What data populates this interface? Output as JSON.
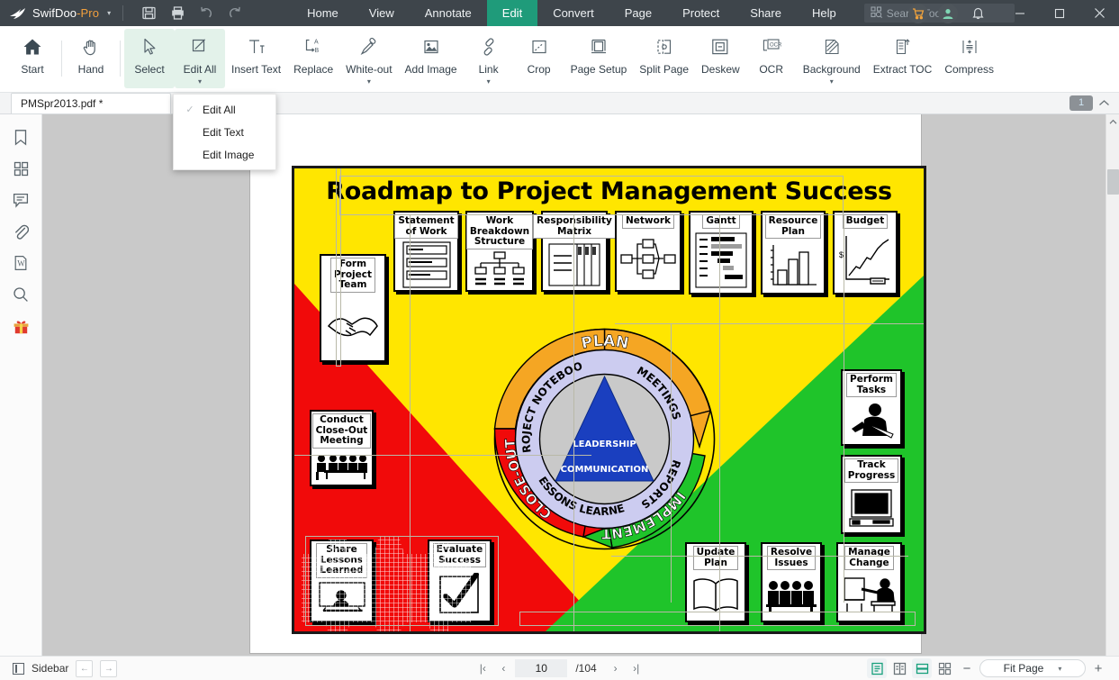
{
  "titlebar": {
    "brand_main": "SwifDoo",
    "brand_suffix": "-Pro",
    "brand_caret": "▾",
    "quick_actions": [
      {
        "name": "save-icon",
        "label": "Save"
      },
      {
        "name": "print-icon",
        "label": "Print"
      },
      {
        "name": "undo-icon",
        "label": "Undo"
      },
      {
        "name": "redo-icon",
        "label": "Redo"
      }
    ],
    "menus": [
      {
        "label": "Home",
        "active": false
      },
      {
        "label": "View",
        "active": false
      },
      {
        "label": "Annotate",
        "active": false
      },
      {
        "label": "Edit",
        "active": true
      },
      {
        "label": "Convert",
        "active": false
      },
      {
        "label": "Page",
        "active": false
      },
      {
        "label": "Protect",
        "active": false
      },
      {
        "label": "Share",
        "active": false
      },
      {
        "label": "Help",
        "active": false
      }
    ],
    "search_placeholder": "Search Tools",
    "accent_active": "#1f9b7a",
    "bar_color": "#3e454b",
    "window_controls": {
      "minimize": "—",
      "maximize": "▢",
      "close": "✕"
    }
  },
  "ribbon": {
    "items": [
      {
        "label": "Start",
        "icon": "home-icon",
        "selected": false,
        "caret": false
      },
      {
        "label": "Hand",
        "icon": "hand-icon",
        "selected": false,
        "caret": false
      },
      {
        "label": "Select",
        "icon": "cursor-icon",
        "selected": true,
        "caret": false
      },
      {
        "label": "Edit All",
        "icon": "edit-all-icon",
        "selected": true,
        "caret": true
      },
      {
        "label": "Insert Text",
        "icon": "insert-text-icon",
        "selected": false,
        "caret": false
      },
      {
        "label": "Replace",
        "icon": "replace-icon",
        "selected": false,
        "caret": false
      },
      {
        "label": "White-out",
        "icon": "whiteout-icon",
        "selected": false,
        "caret": true
      },
      {
        "label": "Add Image",
        "icon": "add-image-icon",
        "selected": false,
        "caret": false
      },
      {
        "label": "Link",
        "icon": "link-icon",
        "selected": false,
        "caret": true
      },
      {
        "label": "Crop",
        "icon": "crop-icon",
        "selected": false,
        "caret": false
      },
      {
        "label": "Page Setup",
        "icon": "page-setup-icon",
        "selected": false,
        "caret": false
      },
      {
        "label": "Split Page",
        "icon": "split-page-icon",
        "selected": false,
        "caret": false
      },
      {
        "label": "Deskew",
        "icon": "deskew-icon",
        "selected": false,
        "caret": false
      },
      {
        "label": "OCR",
        "icon": "ocr-icon",
        "selected": false,
        "caret": false
      },
      {
        "label": "Background",
        "icon": "background-icon",
        "selected": false,
        "caret": true
      },
      {
        "label": "Extract TOC",
        "icon": "extract-toc-icon",
        "selected": false,
        "caret": false
      },
      {
        "label": "Compress",
        "icon": "compress-icon",
        "selected": false,
        "caret": false
      }
    ],
    "selected_bg": "#e3f2ea"
  },
  "dropdown": {
    "items": [
      {
        "label": "Edit All",
        "checked": true
      },
      {
        "label": "Edit Text",
        "checked": false
      },
      {
        "label": "Edit Image",
        "checked": false
      }
    ],
    "check_glyph": "✓"
  },
  "tabbar": {
    "document_tab": "PMSpr2013.pdf *",
    "page_badge": "1",
    "collapse_caret": "⌃"
  },
  "sidebar": {
    "items": [
      {
        "name": "bookmark-icon",
        "label": "Bookmarks"
      },
      {
        "name": "thumbnails-icon",
        "label": "Page Thumbnails"
      },
      {
        "name": "comment-icon",
        "label": "Comments"
      },
      {
        "name": "attachment-icon",
        "label": "Attachments"
      },
      {
        "name": "word-icon",
        "label": "Word"
      },
      {
        "name": "search-icon",
        "label": "Search"
      },
      {
        "name": "gift-icon",
        "label": "Gift"
      }
    ]
  },
  "statusbar": {
    "sidebar_label": "Sidebar",
    "nav_prev": "←",
    "nav_next": "→",
    "page_first": "|‹",
    "page_prev": "‹",
    "page_current": "10",
    "page_total": "/104",
    "page_next": "›",
    "page_last": "›|",
    "view_modes": [
      {
        "name": "single-page-view-icon",
        "active": true
      },
      {
        "name": "two-page-view-icon",
        "active": false
      },
      {
        "name": "continuous-scroll-icon",
        "active": true
      },
      {
        "name": "grid-view-icon",
        "active": false
      }
    ],
    "zoom_out": "−",
    "zoom_in": "+",
    "zoom_level": "Fit Page",
    "zoom_caret": "▾"
  },
  "document": {
    "poster_title": "Roadmap to Project Management Success",
    "colors": {
      "yellow": "#ffe600",
      "red": "#f10a0a",
      "green": "#1fc42a",
      "blue": "#1a3fbf",
      "gray_ring": "#c9c9c9",
      "lavender_ring": "#ccccf0",
      "orange_arc": "#f5a623"
    },
    "top_cards": [
      {
        "caption": "Form Project Team",
        "icon": "handshake-art"
      },
      {
        "caption": "Statement of Work",
        "icon": "document-lines-art"
      },
      {
        "caption": "Work Breakdown Structure",
        "icon": "org-tree-art"
      },
      {
        "caption": "Responsibility Matrix",
        "icon": "matrix-table-art"
      },
      {
        "caption": "Network",
        "icon": "network-nodes-art"
      },
      {
        "caption": "Gantt",
        "icon": "gantt-bars-art"
      },
      {
        "caption": "Resource Plan",
        "icon": "bar-chart-art"
      },
      {
        "caption": "Budget",
        "icon": "line-chart-dollar-art"
      }
    ],
    "left_cards": [
      {
        "caption": "Conduct Close-Out Meeting",
        "icon": "meeting-table-art"
      },
      {
        "caption": "Share Lessons Learned",
        "icon": "presenter-art"
      },
      {
        "caption": "Evaluate Success",
        "icon": "checkmark-art"
      }
    ],
    "right_cards": [
      {
        "caption": "Perform Tasks",
        "icon": "worker-art"
      },
      {
        "caption": "Track Progress",
        "icon": "computer-art"
      },
      {
        "caption": "Update Plan",
        "icon": "open-book-art"
      },
      {
        "caption": "Resolve Issues",
        "icon": "people-row-art"
      },
      {
        "caption": "Manage Change",
        "icon": "whiteboard-presenter-art"
      }
    ],
    "cycle": {
      "outer_labels": [
        {
          "text": "PLAN",
          "color": "#f5a623"
        },
        {
          "text": "IMPLEMENT",
          "color": "#1fc42a"
        },
        {
          "text": "CLOSE-OUT",
          "color": "#f10a0a"
        }
      ],
      "inner_labels": [
        "PROJECT NOTEBOOK",
        "MEETINGS",
        "REPORTS",
        "LESSONS LEARNED"
      ],
      "center_labels": [
        "LEADERSHIP",
        "COMMUNICATION"
      ]
    }
  }
}
